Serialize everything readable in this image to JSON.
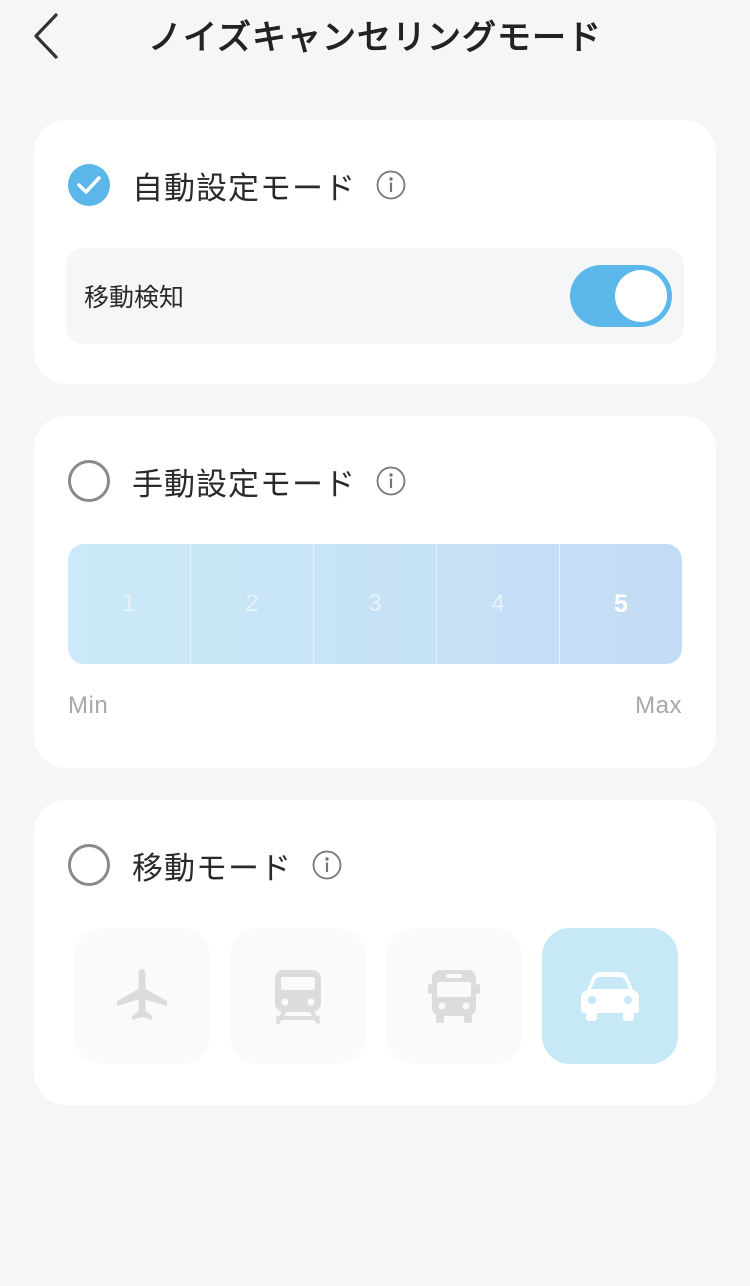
{
  "header": {
    "title": "ノイズキャンセリングモード",
    "back_icon": "chevron-left-icon"
  },
  "auto_mode": {
    "label": "自動設定モード",
    "selected": true,
    "motion_detection": {
      "label": "移動検知",
      "enabled": true
    }
  },
  "manual_mode": {
    "label": "手動設定モード",
    "selected": false,
    "levels": [
      "1",
      "2",
      "3",
      "4",
      "5"
    ],
    "active_level": "5",
    "min_label": "Min",
    "max_label": "Max"
  },
  "travel_mode": {
    "label": "移動モード",
    "selected": false,
    "vehicles": [
      {
        "name": "airplane-icon",
        "selected": false
      },
      {
        "name": "train-icon",
        "selected": false
      },
      {
        "name": "bus-icon",
        "selected": false
      },
      {
        "name": "car-icon",
        "selected": true
      }
    ]
  },
  "colors": {
    "accent": "#5bb6ea",
    "background": "#f5f6f8",
    "card": "#ffffff",
    "vehicle_selected": "#c6e8f7"
  }
}
